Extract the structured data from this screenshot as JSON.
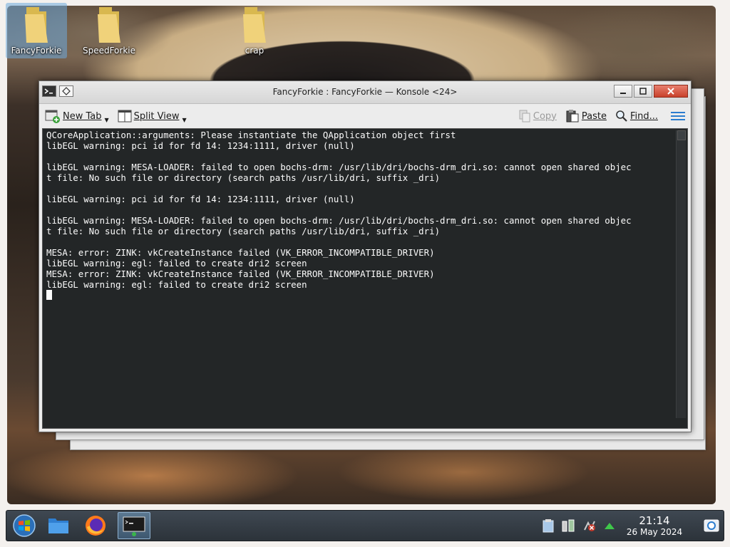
{
  "desktop": {
    "icons": [
      {
        "label": "FancyForkie",
        "icon": "folder-icon",
        "selected": true
      },
      {
        "label": "SpeedForkie",
        "icon": "folder-icon",
        "selected": false
      },
      {
        "label": "crap",
        "icon": "folder-icon",
        "selected": false
      }
    ]
  },
  "window": {
    "title": "FancyForkie : FancyForkie — Konsole <24>",
    "toolbar": {
      "new_tab": "New Tab",
      "split_view": "Split View",
      "copy": "Copy",
      "paste": "Paste",
      "find": "Find..."
    },
    "terminal_lines": [
      "QCoreApplication::arguments: Please instantiate the QApplication object first",
      "libEGL warning: pci id for fd 14: 1234:1111, driver (null)",
      "",
      "libEGL warning: MESA-LOADER: failed to open bochs-drm: /usr/lib/dri/bochs-drm_dri.so: cannot open shared objec",
      "t file: No such file or directory (search paths /usr/lib/dri, suffix _dri)",
      "",
      "libEGL warning: pci id for fd 14: 1234:1111, driver (null)",
      "",
      "libEGL warning: MESA-LOADER: failed to open bochs-drm: /usr/lib/dri/bochs-drm_dri.so: cannot open shared objec",
      "t file: No such file or directory (search paths /usr/lib/dri, suffix _dri)",
      "",
      "MESA: error: ZINK: vkCreateInstance failed (VK_ERROR_INCOMPATIBLE_DRIVER)",
      "libEGL warning: egl: failed to create dri2 screen",
      "MESA: error: ZINK: vkCreateInstance failed (VK_ERROR_INCOMPATIBLE_DRIVER)",
      "libEGL warning: egl: failed to create dri2 screen"
    ],
    "colors": {
      "terminal_bg": "#232627",
      "terminal_fg": "#fcfcfc"
    }
  },
  "taskbar": {
    "items": [
      {
        "name": "start-menu",
        "icon": "windows-orb-icon"
      },
      {
        "name": "file-manager",
        "icon": "folder-icon"
      },
      {
        "name": "firefox",
        "icon": "firefox-icon"
      },
      {
        "name": "konsole",
        "icon": "terminal-icon",
        "active": true
      }
    ],
    "tray": {
      "icons": [
        "clipboard-icon",
        "device-notifier-icon",
        "network-disconnected-icon",
        "expand-arrow-icon",
        "show-desktop-icon"
      ],
      "time": "21:14",
      "date": "26 May 2024"
    }
  }
}
